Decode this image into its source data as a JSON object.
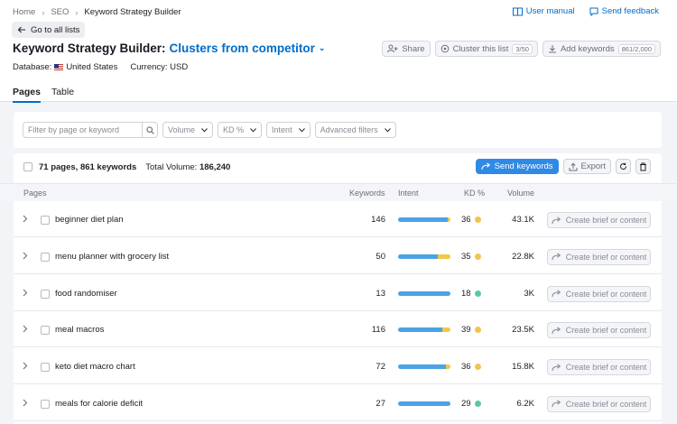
{
  "breadcrumb": {
    "items": [
      "Home",
      "SEO",
      "Keyword Strategy Builder"
    ]
  },
  "top_links": {
    "manual": "User manual",
    "feedback": "Send feedback"
  },
  "back_button": "Go to all lists",
  "title": {
    "main": "Keyword Strategy Builder:",
    "selector": "Clusters from competitor"
  },
  "header_actions": {
    "share": "Share",
    "cluster": "Cluster this list",
    "cluster_count": "3/50",
    "add": "Add keywords",
    "add_count": "861/2,000"
  },
  "meta": {
    "db_label": "Database:",
    "db_value": "United States",
    "currency": "Currency: USD"
  },
  "tabs": [
    {
      "label": "Pages",
      "active": true
    },
    {
      "label": "Table",
      "active": false
    }
  ],
  "filters": {
    "search_placeholder": "Filter by page or keyword",
    "dropdowns": [
      "Volume",
      "KD %",
      "Intent",
      "Advanced filters"
    ]
  },
  "summary": {
    "text": "71 pages, 861 keywords",
    "volume_label": "Total Volume:",
    "volume_value": "186,240"
  },
  "actions": {
    "send": "Send keywords",
    "export": "Export"
  },
  "columns": {
    "pages": "Pages",
    "keywords": "Keywords",
    "intent": "Intent",
    "kd": "KD %",
    "volume": "Volume"
  },
  "colors": {
    "accent": "#006dca",
    "send_button": "#2f8ae6",
    "intent_info": "#4ba3e3",
    "intent_commercial": "#f0c94b",
    "kd_easy": "#f2c44c",
    "kd_very_easy": "#5bc9a0"
  },
  "rows": [
    {
      "page": "beginner diet plan",
      "keywords": "146",
      "intent": [
        0.95,
        0.05
      ],
      "kd": "36",
      "kd_color": "#f2c44c",
      "volume": "43.1K",
      "action": "Create brief or content"
    },
    {
      "page": "menu planner with grocery list",
      "keywords": "50",
      "intent": [
        0.75,
        0.25
      ],
      "kd": "35",
      "kd_color": "#f2c44c",
      "volume": "22.8K",
      "action": "Create brief or content"
    },
    {
      "page": "food randomiser",
      "keywords": "13",
      "intent": [
        1.0,
        0.0
      ],
      "kd": "18",
      "kd_color": "#5bc9a0",
      "volume": "3K",
      "action": "Create brief or content"
    },
    {
      "page": "meal macros",
      "keywords": "116",
      "intent": [
        0.85,
        0.15
      ],
      "kd": "39",
      "kd_color": "#f2c44c",
      "volume": "23.5K",
      "action": "Create brief or content"
    },
    {
      "page": "keto diet macro chart",
      "keywords": "72",
      "intent": [
        0.92,
        0.08
      ],
      "kd": "36",
      "kd_color": "#f2c44c",
      "volume": "15.8K",
      "action": "Create brief or content"
    },
    {
      "page": "meals for calorie deficit",
      "keywords": "27",
      "intent": [
        1.0,
        0.0
      ],
      "kd": "29",
      "kd_color": "#5bc9a0",
      "volume": "6.2K",
      "action": "Create brief or content"
    }
  ]
}
